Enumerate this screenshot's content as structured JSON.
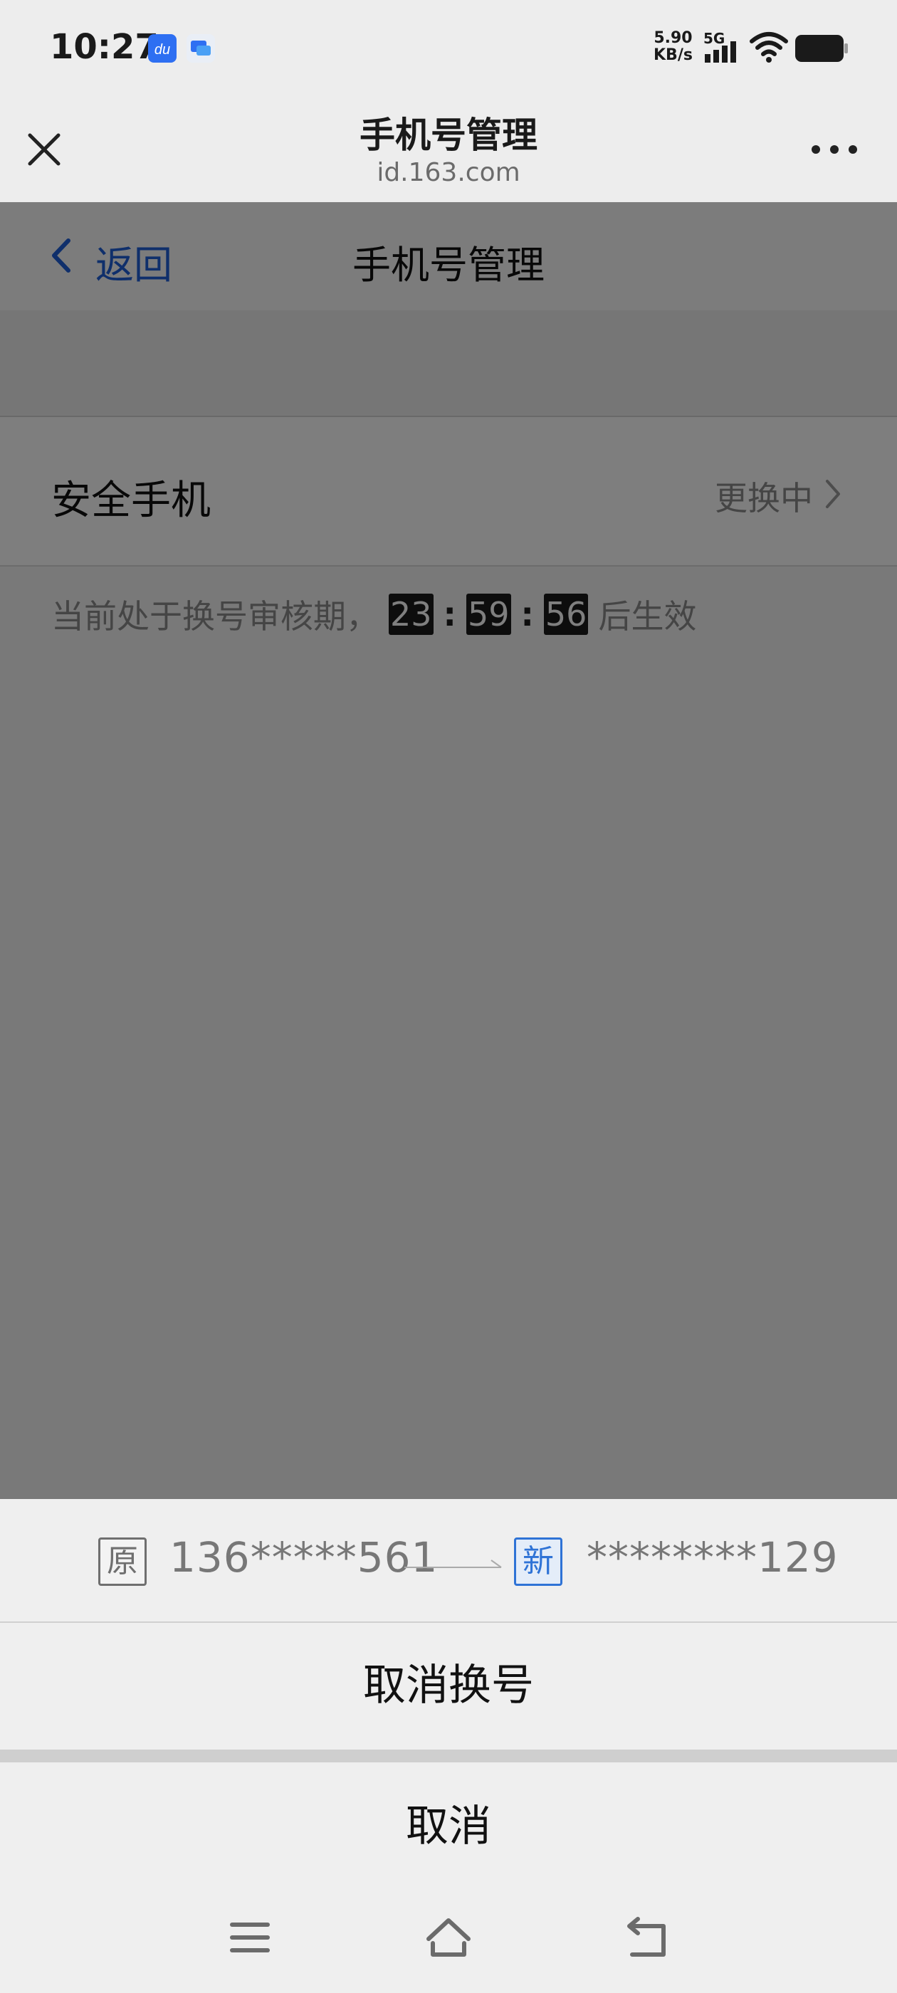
{
  "status_bar": {
    "time": "10:27",
    "net_speed_value": "5.90",
    "net_speed_unit": "KB/s",
    "network": "5G",
    "icons": [
      "baidu-app-icon",
      "chat-app-icon",
      "signal-icon",
      "wifi-icon",
      "battery-icon"
    ]
  },
  "browser": {
    "title": "手机号管理",
    "url": "id.163.com"
  },
  "page": {
    "back_label": "返回",
    "title": "手机号管理",
    "row_label": "安全手机",
    "row_status": "更换中",
    "notice_prefix": "当前处于换号审核期，",
    "countdown": {
      "hours": "23",
      "minutes": "59",
      "seconds": "56",
      "separator": ":"
    },
    "notice_suffix": "后生效"
  },
  "sheet": {
    "old_tag": "原",
    "old_phone": "136*****561",
    "new_tag": "新",
    "new_phone": "********129",
    "cancel_change": "取消换号",
    "cancel": "取消"
  },
  "colors": {
    "link_blue": "#1f5fd6",
    "new_tag_blue": "#2f73d6",
    "overlay": "rgba(0,0,0,0.5)"
  }
}
